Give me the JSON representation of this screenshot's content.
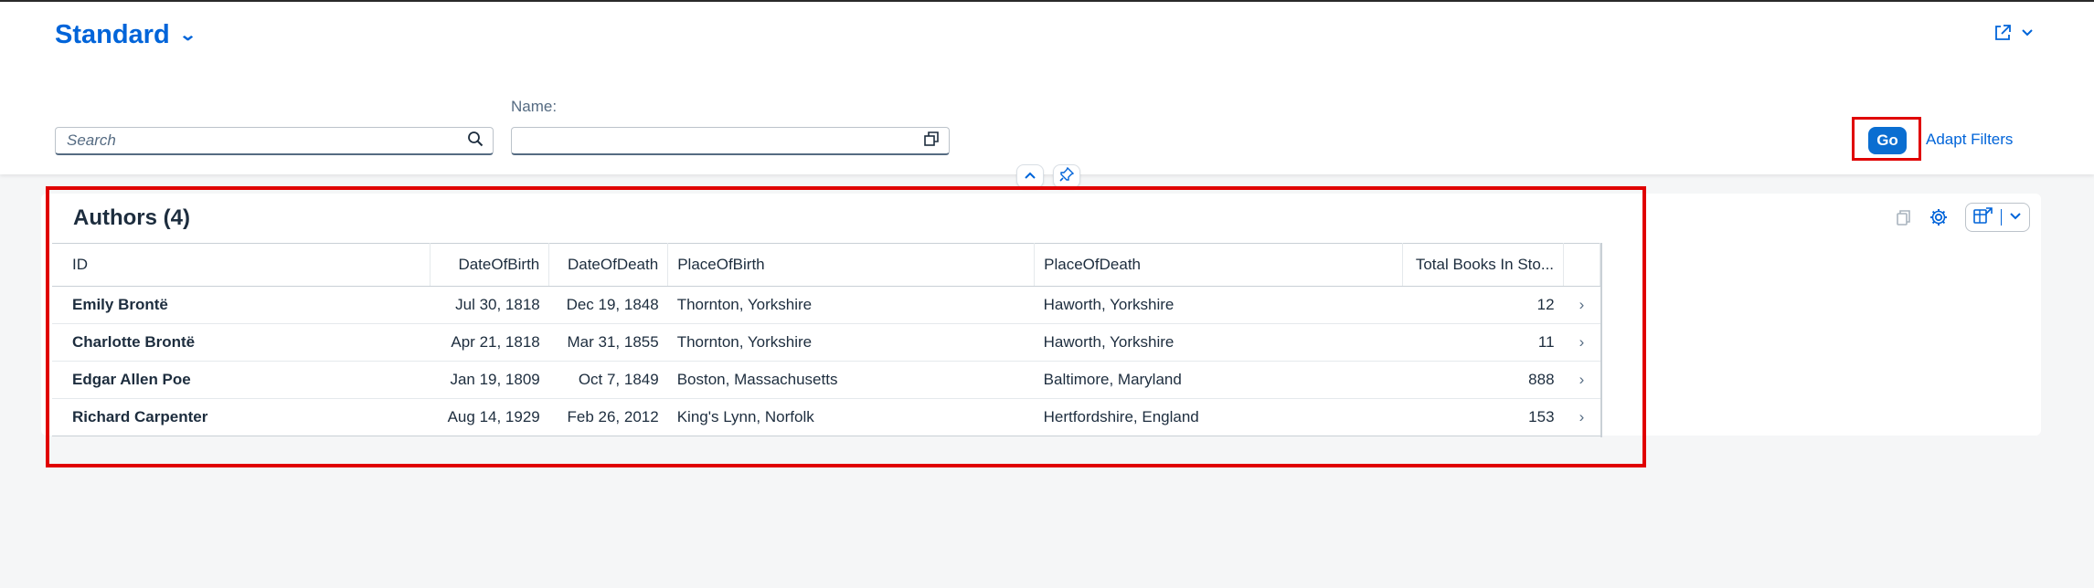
{
  "header": {
    "variant_title": "Standard",
    "variant_icon": "chevron-down-icon",
    "share_icon": "share-icon"
  },
  "filters": {
    "search_placeholder": "Search",
    "name_label": "Name:",
    "name_value": "",
    "go_label": "Go",
    "adapt_label": "Adapt Filters"
  },
  "table": {
    "title": "Authors (4)",
    "columns": [
      "ID",
      "DateOfBirth",
      "DateOfDeath",
      "PlaceOfBirth",
      "PlaceOfDeath",
      "Total Books In Sto..."
    ],
    "rows": [
      [
        "Emily Brontë",
        "Jul 30, 1818",
        "Dec 19, 1848",
        "Thornton, Yorkshire",
        "Haworth, Yorkshire",
        "12"
      ],
      [
        "Charlotte Brontë",
        "Apr 21, 1818",
        "Mar 31, 1855",
        "Thornton, Yorkshire",
        "Haworth, Yorkshire",
        "11"
      ],
      [
        "Edgar Allen Poe",
        "Jan 19, 1809",
        "Oct 7, 1849",
        "Boston, Massachusetts",
        "Baltimore, Maryland",
        "888"
      ],
      [
        "Richard Carpenter",
        "Aug 14, 1929",
        "Feb 26, 2012",
        "King's Lynn, Norfolk",
        "Hertfordshire, England",
        "153"
      ]
    ]
  },
  "colors": {
    "accent": "#0064d9",
    "highlight": "#e00000",
    "go_button": "#0a6ed1"
  }
}
